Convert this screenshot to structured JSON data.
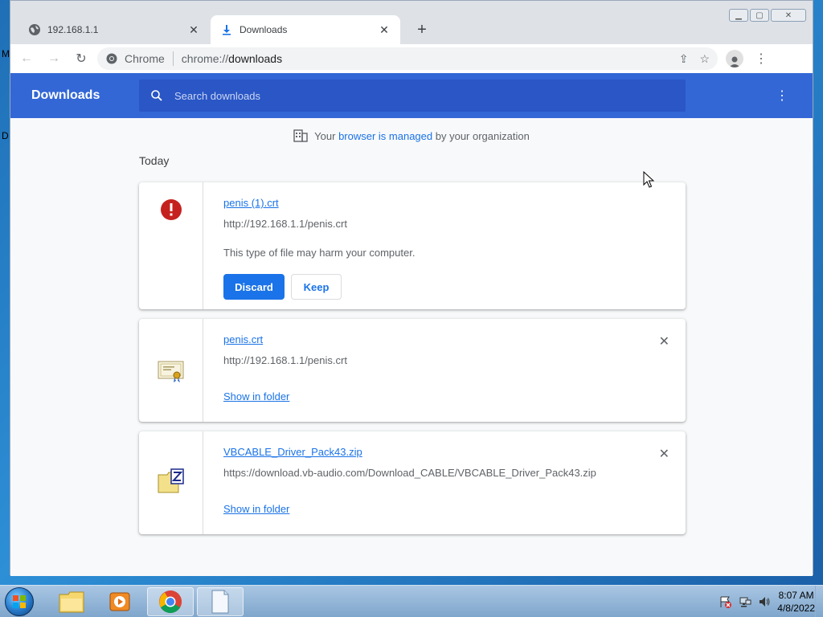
{
  "desktop": {
    "glyph_top": "M",
    "glyph_mid": "D"
  },
  "tabs": [
    {
      "title": "192.168.1.1",
      "icon": "globe-icon"
    },
    {
      "title": "Downloads",
      "icon": "download-icon"
    }
  ],
  "toolbar": {
    "site_label": "Chrome",
    "url_scheme": "chrome://",
    "url_rest": "downloads"
  },
  "page": {
    "title": "Downloads",
    "search_placeholder": "Search downloads",
    "managed_prefix": "Your",
    "managed_link": "browser is managed",
    "managed_suffix": "by your organization",
    "date_group": "Today"
  },
  "downloads": [
    {
      "name": "penis (1).crt",
      "url": "http://192.168.1.1/penis.crt",
      "warning": "This type of file may harm your computer.",
      "discard_label": "Discard",
      "keep_label": "Keep",
      "icon": "danger-icon"
    },
    {
      "name": "penis.crt",
      "url": "http://192.168.1.1/penis.crt",
      "action": "Show in folder",
      "icon": "certificate-icon"
    },
    {
      "name": "VBCABLE_Driver_Pack43.zip",
      "url": "https://download.vb-audio.com/Download_CABLE/VBCABLE_Driver_Pack43.zip",
      "action": "Show in folder",
      "icon": "zip-icon"
    }
  ],
  "taskbar": {
    "time": "8:07 AM",
    "date": "4/8/2022"
  },
  "colors": {
    "accent": "#1a73e8",
    "header": "#3367d6",
    "danger": "#c5221f"
  }
}
